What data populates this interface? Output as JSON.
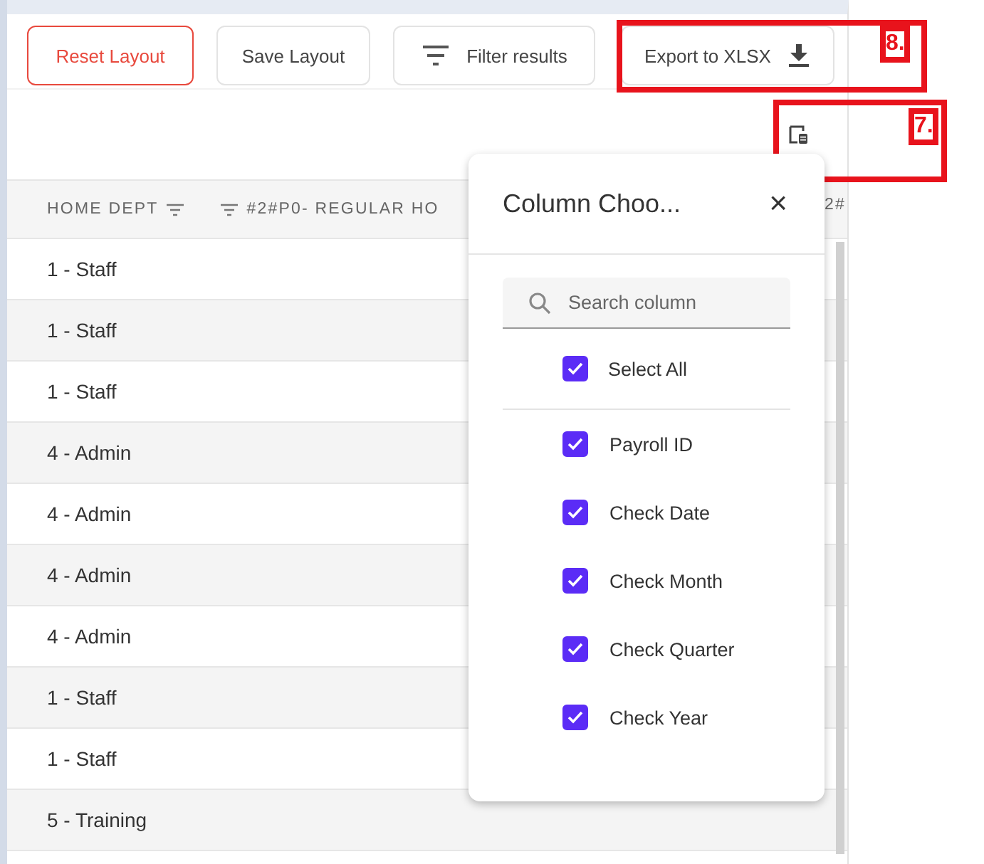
{
  "toolbar": {
    "buttons": [
      {
        "label": "Reset Layout",
        "kind": "danger"
      },
      {
        "label": "Save Layout",
        "kind": "plain"
      },
      {
        "label": "Filter results",
        "kind": "filter"
      },
      {
        "label": "Export to XLSX",
        "kind": "export"
      }
    ]
  },
  "annotations": [
    {
      "label": "8."
    },
    {
      "label": "7."
    }
  ],
  "table": {
    "columns": [
      "HOME DEPT",
      "#2#P0- REGULAR HO",
      "2#"
    ],
    "rows": [
      {
        "home_dept": "1 - Staff"
      },
      {
        "home_dept": "1 - Staff"
      },
      {
        "home_dept": "1 - Staff"
      },
      {
        "home_dept": "4 - Admin"
      },
      {
        "home_dept": "4 - Admin"
      },
      {
        "home_dept": "4 - Admin"
      },
      {
        "home_dept": "4 - Admin"
      },
      {
        "home_dept": "1 - Staff"
      },
      {
        "home_dept": "1 - Staff"
      },
      {
        "home_dept": "5 - Training"
      }
    ]
  },
  "column_chooser": {
    "title": "Column Choo...",
    "close": "×",
    "search": {
      "placeholder": "Search column"
    },
    "select_all": {
      "label": "Select All",
      "checked": true
    },
    "items": [
      {
        "label": "Payroll ID",
        "checked": true
      },
      {
        "label": "Check Date",
        "checked": true
      },
      {
        "label": "Check Month",
        "checked": true
      },
      {
        "label": "Check Quarter",
        "checked": true
      },
      {
        "label": "Check Year",
        "checked": true
      }
    ]
  }
}
